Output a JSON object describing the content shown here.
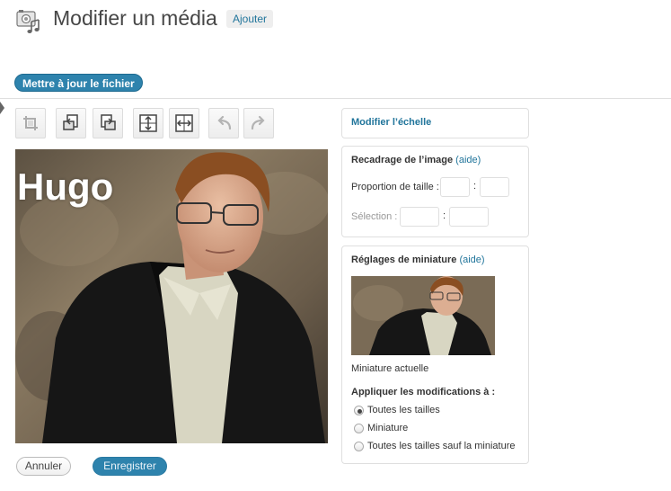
{
  "header": {
    "title": "Modifier un média",
    "add_new_label": "Ajouter",
    "update_file_label": "Mettre à jour le fichier"
  },
  "toolbar": {
    "tools": [
      {
        "icon": "crop-icon",
        "enabled": false
      },
      {
        "icon": "rotate-counterclockwise-icon",
        "enabled": true
      },
      {
        "icon": "rotate-clockwise-icon",
        "enabled": true
      },
      {
        "icon": "flip-vertical-icon",
        "enabled": true
      },
      {
        "icon": "flip-horizontal-icon",
        "enabled": true
      },
      {
        "icon": "undo-icon",
        "enabled": false
      },
      {
        "icon": "redo-icon",
        "enabled": false
      }
    ]
  },
  "image": {
    "overlay_text": "Hugo"
  },
  "actions": {
    "cancel_label": "Annuler",
    "save_label": "Enregistrer"
  },
  "scale_panel": {
    "title": "Modifier l’échelle"
  },
  "crop_panel": {
    "title": "Recadrage de l’image",
    "help": "(aide)",
    "ratio_label": "Proportion de taille :",
    "ratio_w": "",
    "ratio_h": "",
    "selection_label": "Sélection :",
    "sel_w": "",
    "sel_h": "",
    "separator": ":"
  },
  "thumb_panel": {
    "title": "Réglages de miniature",
    "help": "(aide)",
    "current_label": "Miniature actuelle",
    "apply_label": "Appliquer les modifications à :",
    "options": [
      {
        "label": "Toutes les tailles",
        "selected": true
      },
      {
        "label": "Miniature",
        "selected": false
      },
      {
        "label": "Toutes les tailles sauf la miniature",
        "selected": false
      }
    ]
  },
  "colors": {
    "accent": "#21759b",
    "primary_button": "#2e83ad"
  }
}
